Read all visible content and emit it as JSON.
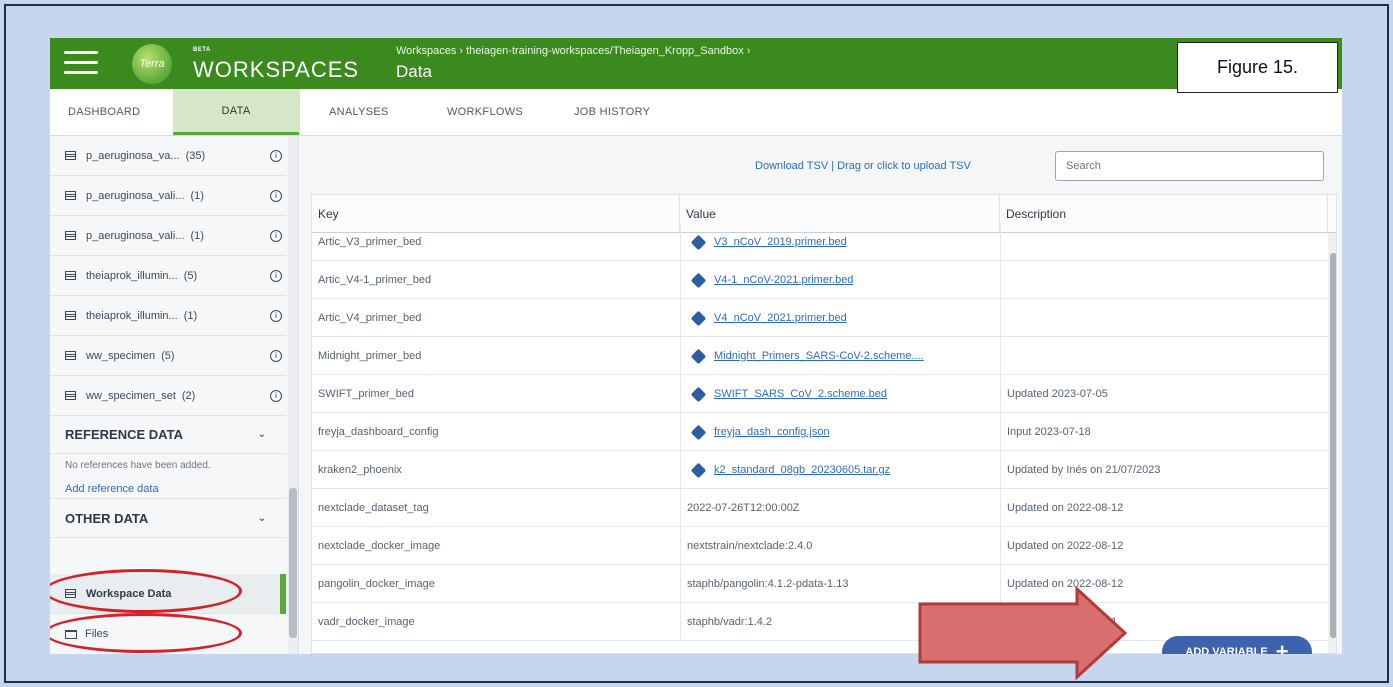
{
  "header": {
    "logo_text": "Terra",
    "beta": "BETA",
    "app_name": "WORKSPACES",
    "breadcrumb": "Workspaces › theiagen-training-workspaces/Theiagen_Kropp_Sandbox ›",
    "page_title": "Data"
  },
  "figure_label": "Figure 15.",
  "tabs": [
    "DASHBOARD",
    "DATA",
    "ANALYSES",
    "WORKFLOWS",
    "JOB HISTORY"
  ],
  "sidebar": {
    "tables": [
      {
        "label": "p_aeruginosa_va...",
        "count": "(35)"
      },
      {
        "label": "p_aeruginosa_vali...",
        "count": "(1)"
      },
      {
        "label": "p_aeruginosa_vali...",
        "count": "(1)"
      },
      {
        "label": "theiaprok_illumin...",
        "count": "(5)"
      },
      {
        "label": "theiaprok_illumin...",
        "count": "(1)"
      },
      {
        "label": "ww_specimen",
        "count": "(5)"
      },
      {
        "label": "ww_specimen_set",
        "count": "(2)"
      }
    ],
    "reference_section": "REFERENCE DATA",
    "reference_note": "No references have been added.",
    "reference_link": "Add reference data",
    "other_section": "OTHER DATA",
    "workspace_data": "Workspace Data",
    "files": "Files"
  },
  "toolbar": {
    "download": "Download TSV",
    "upload": " | Drag or click to upload TSV",
    "search_placeholder": "Search"
  },
  "table": {
    "headers": [
      "Key",
      "Value",
      "Description"
    ],
    "rows": [
      {
        "key": "Artic_V3_primer_bed",
        "value": "V3_nCoV_2019.primer.bed",
        "link": true,
        "desc": ""
      },
      {
        "key": "Artic_V4-1_primer_bed",
        "value": "V4-1_nCoV-2021.primer.bed",
        "link": true,
        "desc": ""
      },
      {
        "key": "Artic_V4_primer_bed",
        "value": "V4_nCoV_2021.primer.bed",
        "link": true,
        "desc": ""
      },
      {
        "key": "Midnight_primer_bed",
        "value": "Midnight_Primers_SARS-CoV-2.scheme....",
        "link": true,
        "desc": ""
      },
      {
        "key": "SWIFT_primer_bed",
        "value": "SWIFT_SARS_CoV_2.scheme.bed",
        "link": true,
        "desc": "Updated 2023-07-05"
      },
      {
        "key": "freyja_dashboard_config",
        "value": "freyja_dash_config.json",
        "link": true,
        "desc": "Input 2023-07-18"
      },
      {
        "key": "kraken2_phoenix",
        "value": "k2_standard_08gb_20230605.tar.gz",
        "link": true,
        "desc": "Updated by Inés on 21/07/2023"
      },
      {
        "key": "nextclade_dataset_tag",
        "value": "2022-07-26T12:00:00Z",
        "link": false,
        "desc": "Updated on 2022-08-12"
      },
      {
        "key": "nextclade_docker_image",
        "value": "nextstrain/nextclade:2.4.0",
        "link": false,
        "desc": "Updated on 2022-08-12"
      },
      {
        "key": "pangolin_docker_image",
        "value": "staphb/pangolin:4.1.2-pdata-1.13",
        "link": false,
        "desc": "Updated on 2022-08-12"
      },
      {
        "key": "vadr_docker_image",
        "value": "staphb/vadr:1.4.2",
        "link": false,
        "desc": "Updated on 2022-07-1"
      }
    ]
  },
  "add_variable": "ADD VARIABLE",
  "colors": {
    "brand_green": "#3a8a1e",
    "link_blue": "#2e6cc0",
    "button_blue": "#3e63ad",
    "annotation_red": "#d2232a",
    "arrow_fill": "#d96f6f"
  }
}
